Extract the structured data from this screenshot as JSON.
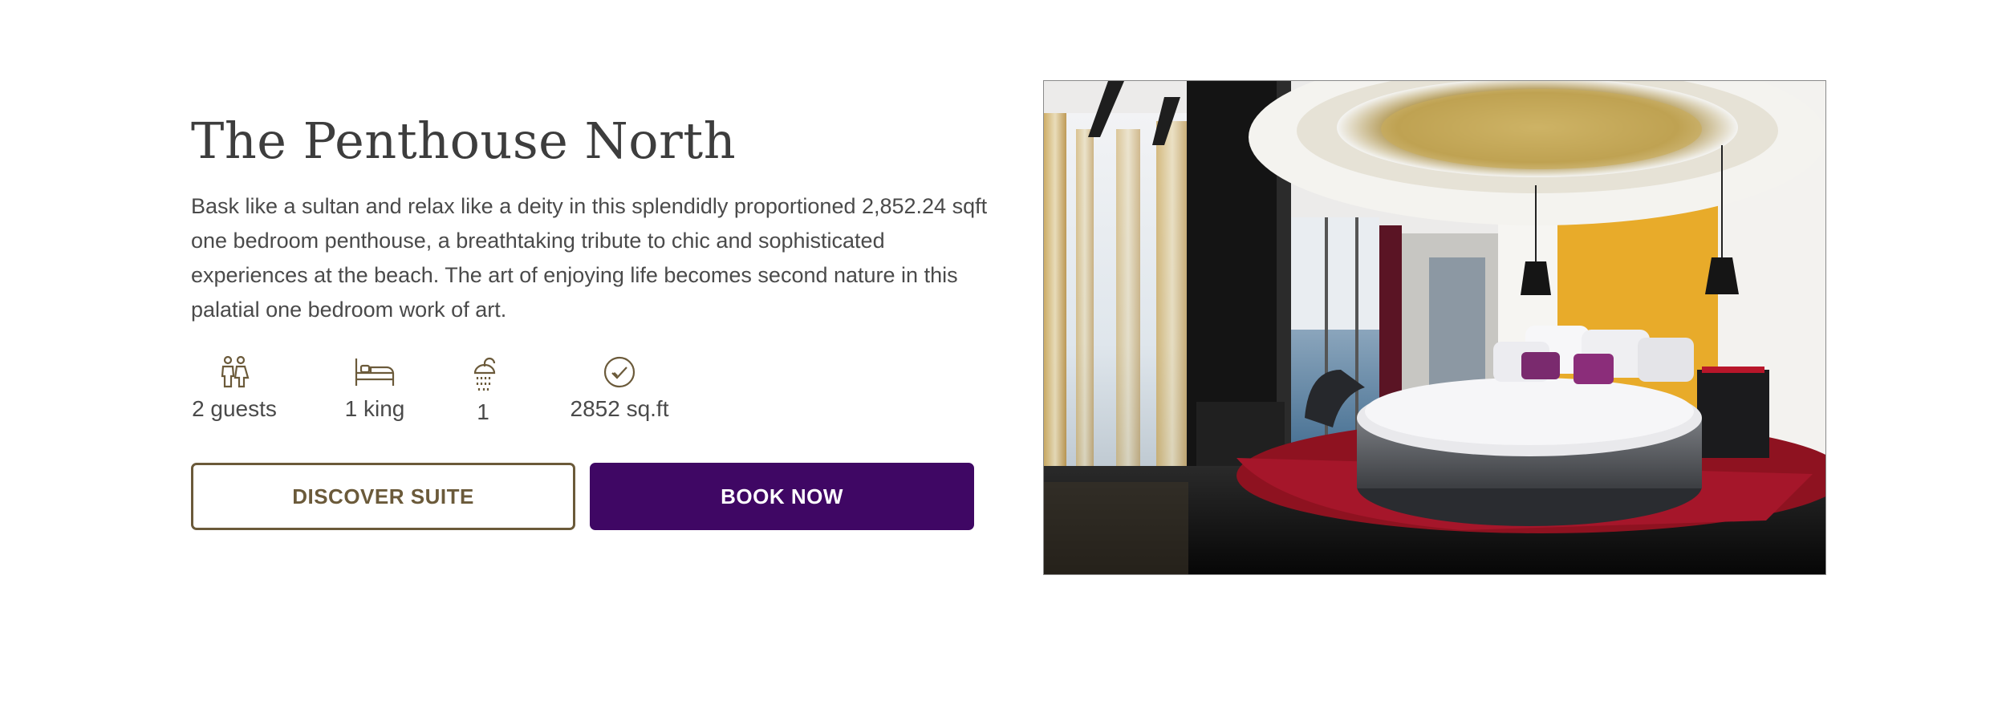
{
  "suite": {
    "title": "The Penthouse North",
    "description": "Bask like a sultan and relax like a deity in this splendidly proportioned 2,852.24 sqft one bedroom penthouse, a breathtaking tribute to chic and sophisticated experiences at the beach. The art of enjoying life becomes second nature in this palatial one bedroom work of art."
  },
  "amenities": [
    {
      "icon": "guests-icon",
      "label": "2 guests"
    },
    {
      "icon": "bed-icon",
      "label": "1 king"
    },
    {
      "icon": "shower-icon",
      "label": "1"
    },
    {
      "icon": "check-circle-icon",
      "label": "2852 sq.ft"
    }
  ],
  "buttons": {
    "discover_label": "DISCOVER SUITE",
    "book_label": "BOOK NOW"
  },
  "colors": {
    "brand_gold": "#6b5a3a",
    "brand_purple": "#3f0764",
    "text": "#4a4a4a"
  }
}
